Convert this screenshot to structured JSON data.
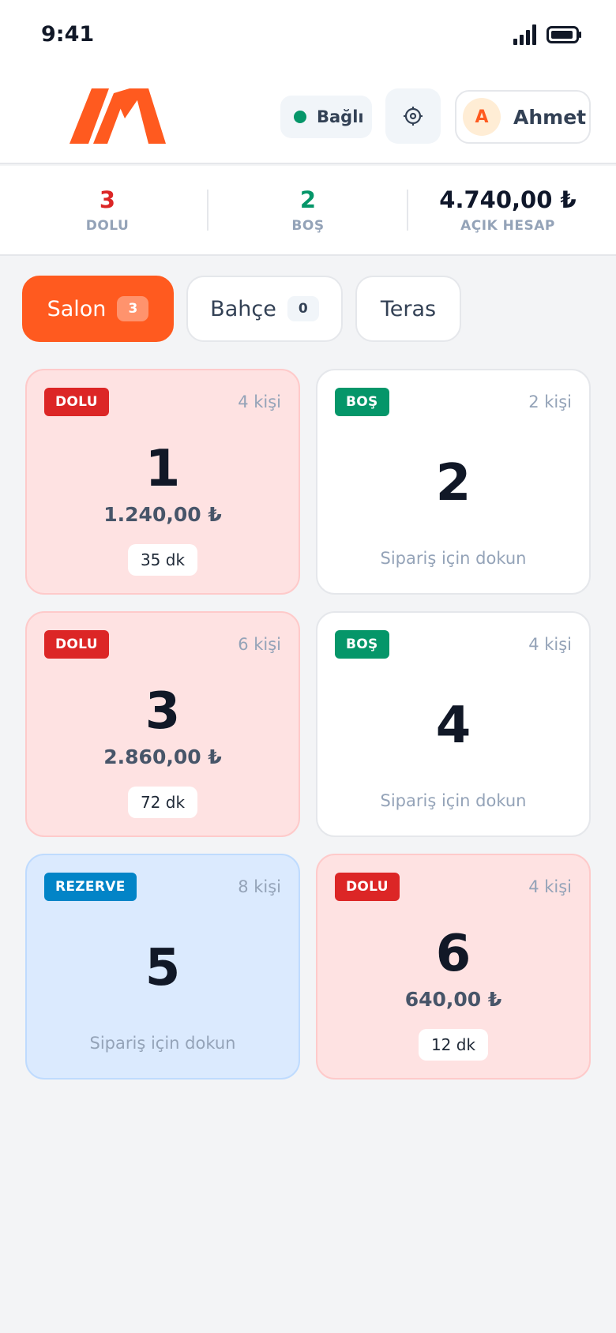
{
  "status_bar": {
    "time": "9:41"
  },
  "header": {
    "logo": "M",
    "connection_label": "Bağlı",
    "settings_icon": "settings-icon",
    "user_initial": "A",
    "user_name": "Ahmet"
  },
  "colors": {
    "accent": "#ff5a1f",
    "occupied": "#dc2626",
    "free": "#059669",
    "reserved": "#0284c7",
    "occupied_bg": "#fee2e2",
    "reserved_bg": "#dbeafe"
  },
  "summary": {
    "occupied": {
      "value": "3",
      "label": "DOLU"
    },
    "free": {
      "value": "2",
      "label": "BOŞ"
    },
    "open_bill": {
      "value": "4.740,00 ₺",
      "label": "AÇIK HESAP"
    }
  },
  "tabs": [
    {
      "label": "Salon",
      "badge": "3",
      "active": true
    },
    {
      "label": "Bahçe",
      "badge": "0",
      "active": false
    },
    {
      "label": "Teras",
      "badge": null,
      "active": false
    }
  ],
  "tables": [
    {
      "number": "1",
      "status": "DOLU",
      "capacity": "4 kişi",
      "amount": "1.240,00 ₺",
      "duration": "35 dk"
    },
    {
      "number": "2",
      "status": "BOŞ",
      "capacity": "2 kişi",
      "hint": "Sipariş için dokun"
    },
    {
      "number": "3",
      "status": "DOLU",
      "capacity": "6 kişi",
      "amount": "2.860,00 ₺",
      "duration": "72 dk"
    },
    {
      "number": "4",
      "status": "BOŞ",
      "capacity": "4 kişi",
      "hint": "Sipariş için dokun"
    },
    {
      "number": "5",
      "status": "REZERVE",
      "capacity": "8 kişi",
      "hint": "Sipariş için dokun"
    },
    {
      "number": "6",
      "status": "DOLU",
      "capacity": "4 kişi",
      "amount": "640,00 ₺",
      "duration": "12 dk"
    }
  ]
}
